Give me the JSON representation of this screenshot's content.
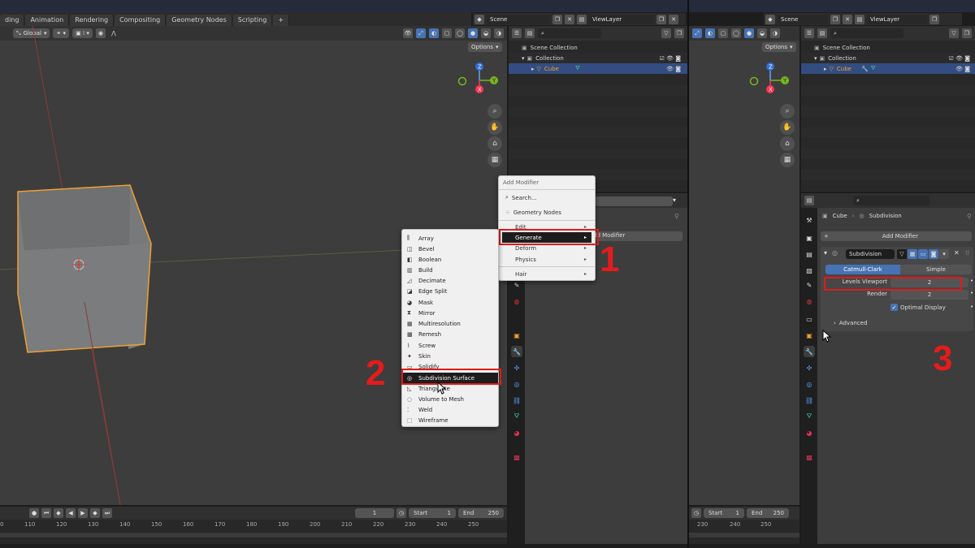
{
  "workspace_tabs": [
    "ding",
    "Animation",
    "Rendering",
    "Compositing",
    "Geometry Nodes",
    "Scripting",
    "+"
  ],
  "scene_label": "Scene",
  "viewlayer_label": "ViewLayer",
  "transform_orientation": "Global",
  "options_label": "Options",
  "outliner": {
    "rows": [
      "Scene Collection",
      "Collection",
      "Cube"
    ]
  },
  "add_modifier_menu": {
    "title": "Add Modifier",
    "items": [
      {
        "label": "Search...",
        "arrow": ""
      },
      {
        "label": "Geometry Nodes",
        "arrow": ""
      },
      {
        "label": "Edit",
        "arrow": "▸"
      },
      {
        "label": "Generate",
        "arrow": "▸"
      },
      {
        "label": "Deform",
        "arrow": "▸"
      },
      {
        "label": "Physics",
        "arrow": "▸"
      },
      {
        "label": "Hair",
        "arrow": "▸"
      }
    ]
  },
  "generate_menu": {
    "items": [
      "Array",
      "Bevel",
      "Boolean",
      "Build",
      "Decimate",
      "Edge Split",
      "Mask",
      "Mirror",
      "Multiresolution",
      "Remesh",
      "Screw",
      "Skin",
      "Solidify",
      "Subdivision Surface",
      "Triangulate",
      "Volume to Mesh",
      "Weld",
      "Wireframe"
    ],
    "selected": "Subdivision Surface"
  },
  "props_left": {
    "add_modifier_partial": "dd Modifier"
  },
  "props_right": {
    "breadcrumb_object": "Cube",
    "breadcrumb_sep": "›",
    "breadcrumb_modifier": "Subdivision",
    "add_modifier": "Add Modifier",
    "modifier_name": "Subdivision",
    "mode_a": "Catmull-Clark",
    "mode_b": "Simple",
    "levels_viewport_label": "Levels Viewport",
    "levels_viewport_value": "2",
    "render_label": "Render",
    "render_value": "2",
    "optimal_display_label": "Optimal Display",
    "advanced_label": "Advanced"
  },
  "timeline_left": {
    "frame": "1",
    "start_label": "Start",
    "start_value": "1",
    "end_label": "End",
    "end_value": "250",
    "ticks": [
      "0",
      "110",
      "120",
      "130",
      "140",
      "150",
      "160",
      "170",
      "180",
      "190",
      "200",
      "210",
      "220",
      "230",
      "240",
      "250"
    ]
  },
  "timeline_right": {
    "start_label": "Start",
    "start_value": "1",
    "end_label": "End",
    "end_value": "250",
    "ticks": [
      "230",
      "240",
      "250"
    ]
  },
  "step_numbers": {
    "one": "1",
    "two": "2",
    "three": "3"
  },
  "colors": {
    "highlight_red": "#e01b1b",
    "select_blue": "#4772b3",
    "cube_outline": "#f0a030"
  }
}
